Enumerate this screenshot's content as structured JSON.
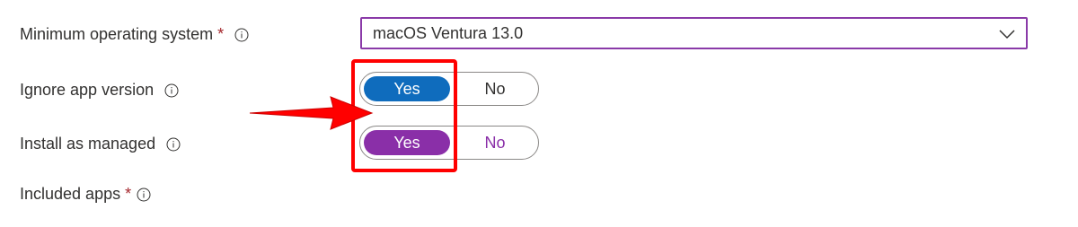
{
  "fields": {
    "min_os": {
      "label": "Minimum operating system",
      "required_mark": "*",
      "value": "macOS Ventura 13.0"
    },
    "ignore_app_version": {
      "label": "Ignore app version",
      "yes_label": "Yes",
      "no_label": "No",
      "selected": "Yes"
    },
    "install_as_managed": {
      "label": "Install as managed",
      "yes_label": "Yes",
      "no_label": "No",
      "selected": "Yes"
    },
    "included_apps": {
      "label": "Included apps",
      "required_mark": "*"
    }
  },
  "icons": {
    "info": "info-icon",
    "dropdown": "chevron-down-icon",
    "annotation_arrow": "arrow-right-icon"
  },
  "colors": {
    "dropdown_border": "#8a3aa8",
    "toggle_blue": "#0f6cbd",
    "toggle_purple": "#8a2fa8",
    "required": "#a4262c",
    "annotation": "#ff0000"
  }
}
